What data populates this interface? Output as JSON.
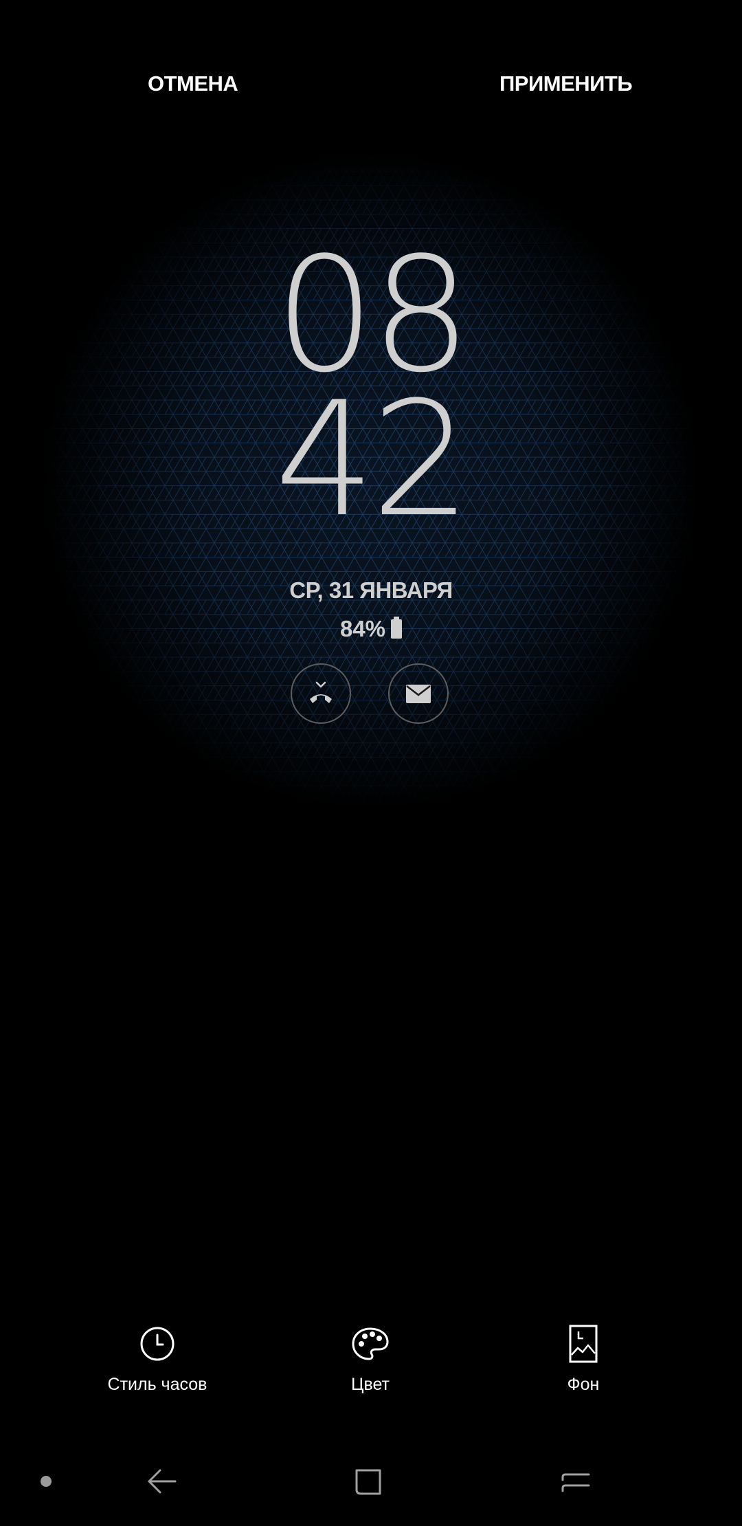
{
  "topbar": {
    "cancel_label": "ОТМЕНА",
    "apply_label": "ПРИМЕНИТЬ"
  },
  "clock": {
    "hours": "08",
    "minutes": "42",
    "date": "СР, 31 ЯНВАРЯ",
    "battery": "84%"
  },
  "notifications": [
    {
      "icon": "missed-call-icon"
    },
    {
      "icon": "email-icon"
    }
  ],
  "tools": [
    {
      "label": "Стиль часов",
      "icon": "clock-icon"
    },
    {
      "label": "Цвет",
      "icon": "palette-icon"
    },
    {
      "label": "Фон",
      "icon": "wallpaper-icon"
    }
  ],
  "navbar": {
    "items": [
      "dot-icon",
      "back-icon",
      "home-icon",
      "recents-icon"
    ]
  },
  "colors": {
    "background": "#000000",
    "text": "#ffffff",
    "clock_text": "#cfcfcf",
    "pattern_line": "#2a5f9a"
  }
}
